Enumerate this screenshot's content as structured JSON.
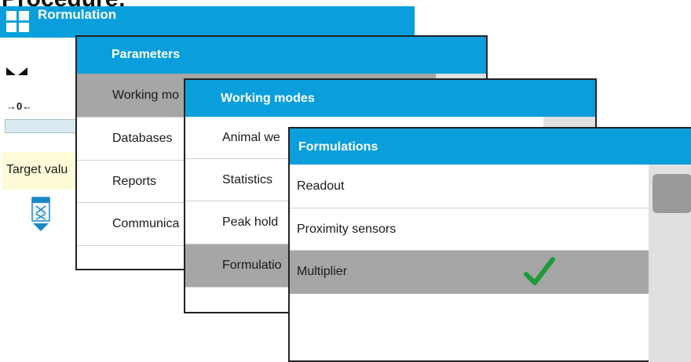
{
  "page": {
    "heading": "Procedure:"
  },
  "main_screen": {
    "title": "Rormulation",
    "icons": [
      "menu-grid-icon",
      "stability-marker-icon",
      "zero-marker-icon",
      "formula-keypad-icon"
    ],
    "zero_label": "→0←",
    "target_label": "Target valu"
  },
  "parameters": {
    "title": "Parameters",
    "items": [
      "Working mo",
      "Databases",
      "Reports",
      "Communica",
      ""
    ],
    "selected_index": 0
  },
  "working_modes": {
    "title": "Working modes",
    "items": [
      "Animal we",
      "Statistics",
      "Peak hold",
      "Formulatio",
      ""
    ],
    "selected_index": 3
  },
  "formulations": {
    "title": "Formulations",
    "items": [
      "Readout",
      "Proximity sensors",
      "Multiplier",
      ""
    ],
    "selected_index": 2,
    "checked_index": 2,
    "check_icon": "checkmark-icon",
    "check_color": "#1e9a3a"
  },
  "colors": {
    "accent": "#0a9fdc",
    "selected_row": "#a6a6a6",
    "target_bg": "#fefcd8",
    "bar_bg": "#dbe9f1"
  }
}
